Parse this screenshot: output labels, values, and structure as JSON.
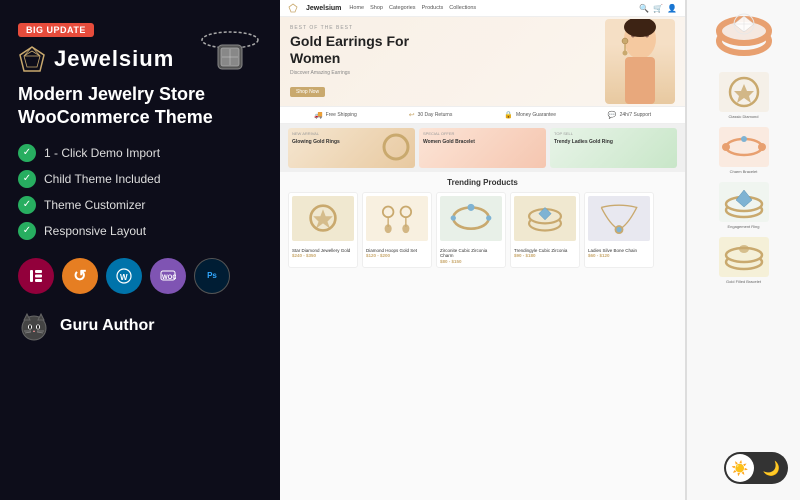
{
  "badge": "Big Update",
  "brand": {
    "name": "Jewelsium",
    "tagline": "Modern Jewelry Store\nWooCommerce Theme"
  },
  "features": [
    "1 - Click Demo Import",
    "Child Theme Included",
    "Theme Customizer",
    "Responsive Layout"
  ],
  "plugins": [
    {
      "label": "E",
      "class": "badge-elementor",
      "name": "Elementor"
    },
    {
      "label": "↺",
      "class": "badge-customizer",
      "name": "Customizer"
    },
    {
      "label": "W",
      "class": "badge-wp",
      "name": "WordPress"
    },
    {
      "label": "Wo",
      "class": "badge-woo",
      "name": "WooCommerce"
    },
    {
      "label": "Ps",
      "class": "badge-ps",
      "name": "Photoshop"
    }
  ],
  "author": {
    "label": "Guru Author"
  },
  "preview": {
    "nav_logo": "Jewelsium",
    "nav_items": [
      "Home",
      "Shop",
      "Categories",
      "Products",
      "Collections"
    ],
    "hero_label": "BEST OF THE BEST",
    "hero_title": "Gold Earrings For\nWomen",
    "hero_cta": "Shop Now",
    "features_bar": [
      {
        "icon": "🚚",
        "text": "Free Shipping"
      },
      {
        "icon": "↩",
        "text": "30 Day Returns"
      },
      {
        "icon": "🔒",
        "text": "Money Guarantee"
      },
      {
        "icon": "💬",
        "text": "24h/7 Support"
      }
    ],
    "banners": [
      {
        "label": "Glowing Gold Rings",
        "sublabel": "New Arrival"
      },
      {
        "label": "Women Gold Bracelet",
        "sublabel": "Special Offer"
      },
      {
        "label": "Trendy Ladies Gold Ring",
        "sublabel": "Top Sell"
      }
    ],
    "section_title": "Trending Products",
    "products": [
      {
        "name": "Star Diamond Jewellery Gold",
        "price": "$240 - $350",
        "color": "#f0e8d0"
      },
      {
        "name": "Diamond Hoops Gold Set",
        "price": "$120 - $200",
        "color": "#f8f0e0"
      },
      {
        "name": "Zirconite Cubic Zirconia Charm",
        "price": "$80 - $150",
        "color": "#e8f0e8"
      },
      {
        "name": "Trendingyle Cubic Zirconia",
        "price": "$90 - $180",
        "color": "#f0e8d0"
      },
      {
        "name": "Ladies Silve Bone Chain",
        "price": "$60 - $120",
        "color": "#e8e8f0"
      }
    ],
    "side_items": [
      {
        "label": "Classic Diamond",
        "color": "#f5f0e8"
      },
      {
        "label": "Charm Bracelet",
        "color": "#faeae0"
      },
      {
        "label": "Engagement Ring",
        "color": "#f0f5f0"
      },
      {
        "label": "Gold Filled Bracelet",
        "color": "#f5f0d8"
      }
    ]
  },
  "toggle": {
    "light_symbol": "☀️",
    "dark_symbol": "🌙"
  }
}
